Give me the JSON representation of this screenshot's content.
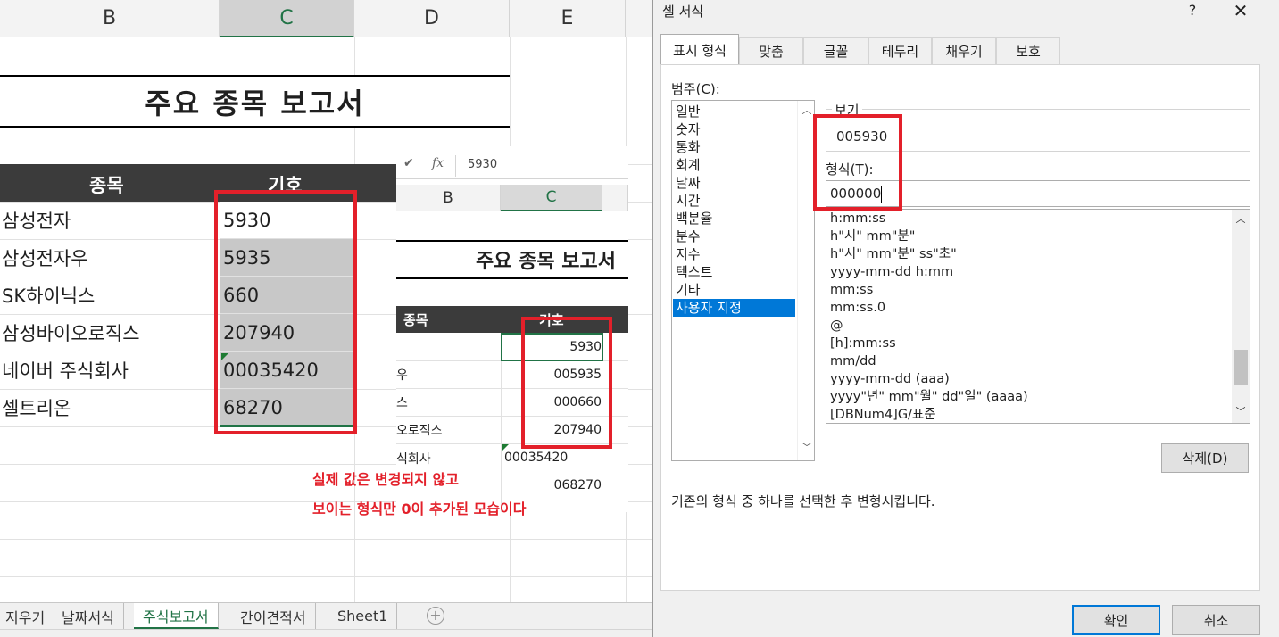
{
  "sheet": {
    "columns": [
      "B",
      "C",
      "D",
      "E"
    ],
    "title": "주요 종목 보고서",
    "header": {
      "name": "종목",
      "code": "기호"
    },
    "rows": [
      {
        "name": "삼성전자",
        "code": "5930"
      },
      {
        "name": "삼성전자우",
        "code": "5935"
      },
      {
        "name": "SK하이닉스",
        "code": "660"
      },
      {
        "name": "삼성바이오로직스",
        "code": "207940"
      },
      {
        "name": "네이버 주식회사",
        "code": "00035420"
      },
      {
        "name": "셀트리온",
        "code": "68270"
      }
    ],
    "annotation_line1": "실제 값은 변경되지 않고",
    "annotation_line2": "보이는 형식만 0이 추가된 모습이다",
    "tabs": [
      "지우기",
      "날짜서식",
      "주식보고서",
      "간이견적서",
      "Sheet1"
    ],
    "active_tab": "주식보고서",
    "add_sheet_icon": "plus-circle-icon"
  },
  "inset": {
    "formula_value": "5930",
    "check_icon": "✔",
    "fx_label": "fx",
    "columns": [
      "B",
      "C"
    ],
    "title": "주요 종목 보고서",
    "header": {
      "name": "종목",
      "code": "기호"
    },
    "name_fragments": [
      "우",
      "스",
      "오로직스",
      "식회사"
    ],
    "values": [
      "5930",
      "005935",
      "000660",
      "207940",
      "00035420",
      "068270"
    ]
  },
  "dialog": {
    "title": "셀 서식",
    "help": "?",
    "close": "✕",
    "tabs": [
      "표시 형식",
      "맞춤",
      "글꼴",
      "테두리",
      "채우기",
      "보호"
    ],
    "category_label": "범주(C):",
    "categories": [
      "일반",
      "숫자",
      "통화",
      "회계",
      "날짜",
      "시간",
      "백분율",
      "분수",
      "지수",
      "텍스트",
      "기타",
      "사용자 지정"
    ],
    "selected_category": "사용자 지정",
    "sample_label": "보기",
    "sample_value": "005930",
    "format_label": "형식(T):",
    "format_value": "000000",
    "formats": [
      "h:mm:ss",
      "h\"시\" mm\"분\"",
      "h\"시\" mm\"분\" ss\"초\"",
      "yyyy-mm-dd h:mm",
      "mm:ss",
      "mm:ss.0",
      "@",
      "[h]:mm:ss",
      "mm/dd",
      "yyyy-mm-dd (aaa)",
      "yyyy\"년\" mm\"월\" dd\"일\" (aaaa)",
      "[DBNum4]G/표준"
    ],
    "delete_label": "삭제(D)",
    "description": "기존의 형식 중 하나를 선택한 후 변형시킵니다.",
    "ok_label": "확인",
    "cancel_label": "취소"
  },
  "colors": {
    "highlight_red": "#e3202a",
    "excel_green": "#217346",
    "selection_blue": "#0078d7"
  }
}
